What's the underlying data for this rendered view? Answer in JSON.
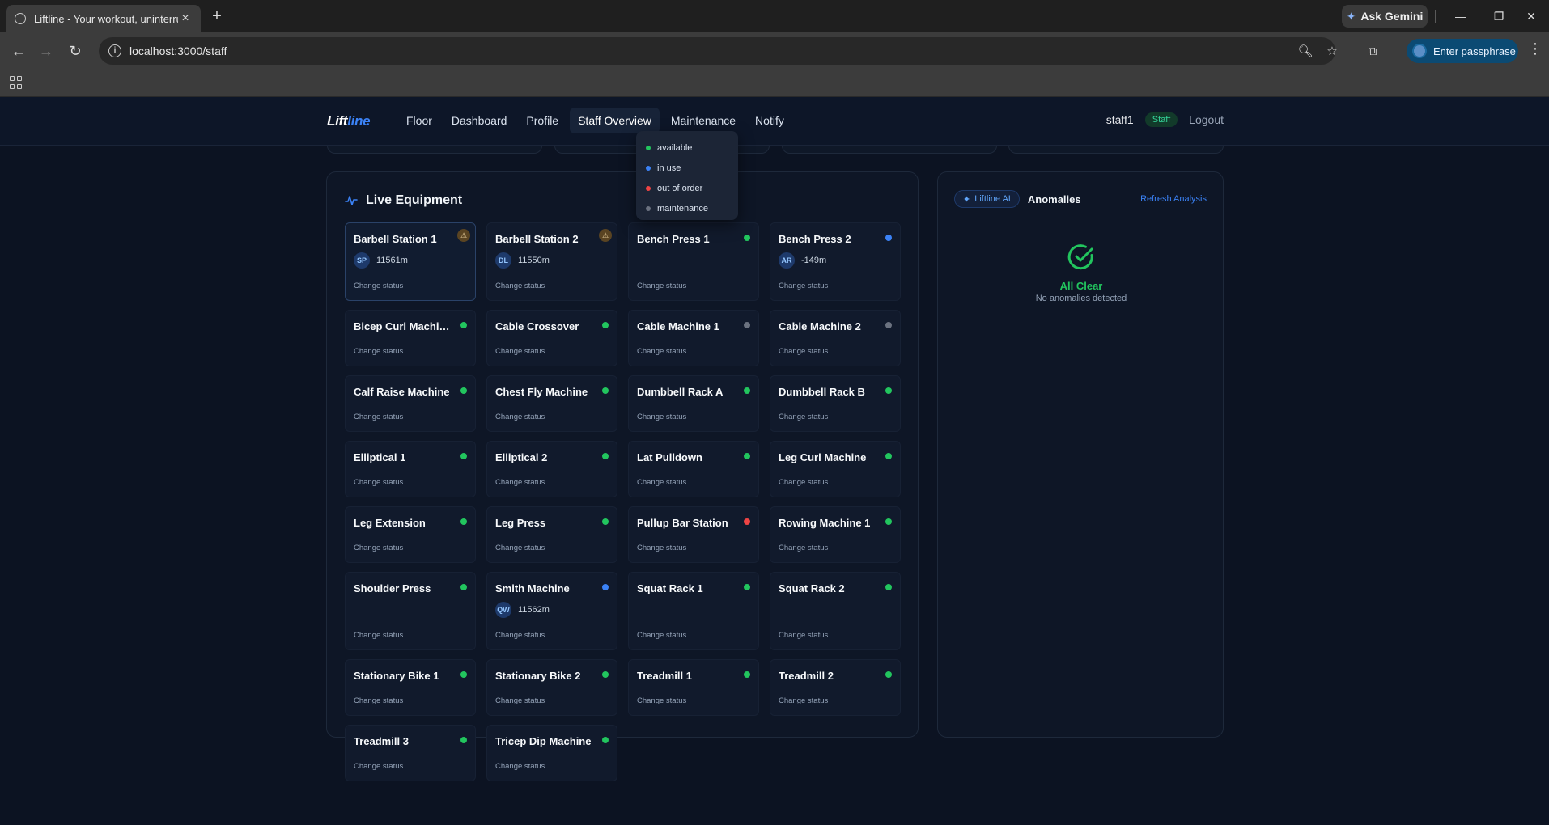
{
  "browser": {
    "tab_title": "Liftline - Your workout, uninterrupted",
    "url": "localhost:3000/staff",
    "gemini_label": "Ask Gemini",
    "passphrase_label": "Enter passphrase"
  },
  "app": {
    "logo_part1": "Lift",
    "logo_part2": "line",
    "nav": [
      "Floor",
      "Dashboard",
      "Profile",
      "Staff Overview",
      "Maintenance",
      "Notify"
    ],
    "active_nav": "Staff Overview",
    "username": "staff1",
    "role_badge": "Staff",
    "logout_label": "Logout"
  },
  "legend": [
    {
      "label": "available",
      "color": "#22c55e"
    },
    {
      "label": "in use",
      "color": "#3b82f6"
    },
    {
      "label": "out of order",
      "color": "#ef4444"
    },
    {
      "label": "maintenance",
      "color": "#6b7280"
    }
  ],
  "equipment_panel": {
    "title": "Live Equipment",
    "change_label": "Change status",
    "items": [
      {
        "name": "Barbell Station 1",
        "status": "in use",
        "user_initials": "SP",
        "duration": "11561m",
        "alert": true,
        "selected": true
      },
      {
        "name": "Barbell Station 2",
        "status": "in use",
        "user_initials": "DL",
        "duration": "11550m",
        "alert": true
      },
      {
        "name": "Bench Press 1",
        "status": "available"
      },
      {
        "name": "Bench Press 2",
        "status": "in use",
        "user_initials": "AR",
        "duration": "-149m"
      },
      {
        "name": "Bicep Curl Machine",
        "status": "available"
      },
      {
        "name": "Cable Crossover",
        "status": "available"
      },
      {
        "name": "Cable Machine 1",
        "status": "maintenance"
      },
      {
        "name": "Cable Machine 2",
        "status": "maintenance"
      },
      {
        "name": "Calf Raise Machine",
        "status": "available"
      },
      {
        "name": "Chest Fly Machine",
        "status": "available"
      },
      {
        "name": "Dumbbell Rack A",
        "status": "available"
      },
      {
        "name": "Dumbbell Rack B",
        "status": "available"
      },
      {
        "name": "Elliptical 1",
        "status": "available"
      },
      {
        "name": "Elliptical 2",
        "status": "available"
      },
      {
        "name": "Lat Pulldown",
        "status": "available"
      },
      {
        "name": "Leg Curl Machine",
        "status": "available"
      },
      {
        "name": "Leg Extension",
        "status": "available"
      },
      {
        "name": "Leg Press",
        "status": "available"
      },
      {
        "name": "Pullup Bar Station",
        "status": "out of order"
      },
      {
        "name": "Rowing Machine 1",
        "status": "available"
      },
      {
        "name": "Shoulder Press",
        "status": "available"
      },
      {
        "name": "Smith Machine",
        "status": "in use",
        "user_initials": "QW",
        "duration": "11562m"
      },
      {
        "name": "Squat Rack 1",
        "status": "available"
      },
      {
        "name": "Squat Rack 2",
        "status": "available"
      },
      {
        "name": "Stationary Bike 1",
        "status": "available"
      },
      {
        "name": "Stationary Bike 2",
        "status": "available"
      },
      {
        "name": "Treadmill 1",
        "status": "available"
      },
      {
        "name": "Treadmill 2",
        "status": "available"
      },
      {
        "name": "Treadmill 3",
        "status": "available"
      },
      {
        "name": "Tricep Dip Machine",
        "status": "available"
      }
    ]
  },
  "ai_panel": {
    "pill_label": "Liftline AI",
    "title": "Anomalies",
    "refresh_label": "Refresh Analysis",
    "status_title": "All Clear",
    "status_subtitle": "No anomalies detected"
  }
}
